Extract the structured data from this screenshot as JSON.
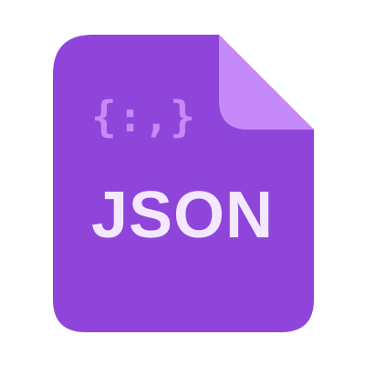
{
  "icon": {
    "name": "json-file-icon",
    "symbol": "{:,}",
    "label": "JSON"
  },
  "colors": {
    "background": "#ffffff",
    "body": "#8f45da",
    "fold": "#c58af8",
    "symbol": "#c58af8",
    "label": "#f3e8ff"
  }
}
